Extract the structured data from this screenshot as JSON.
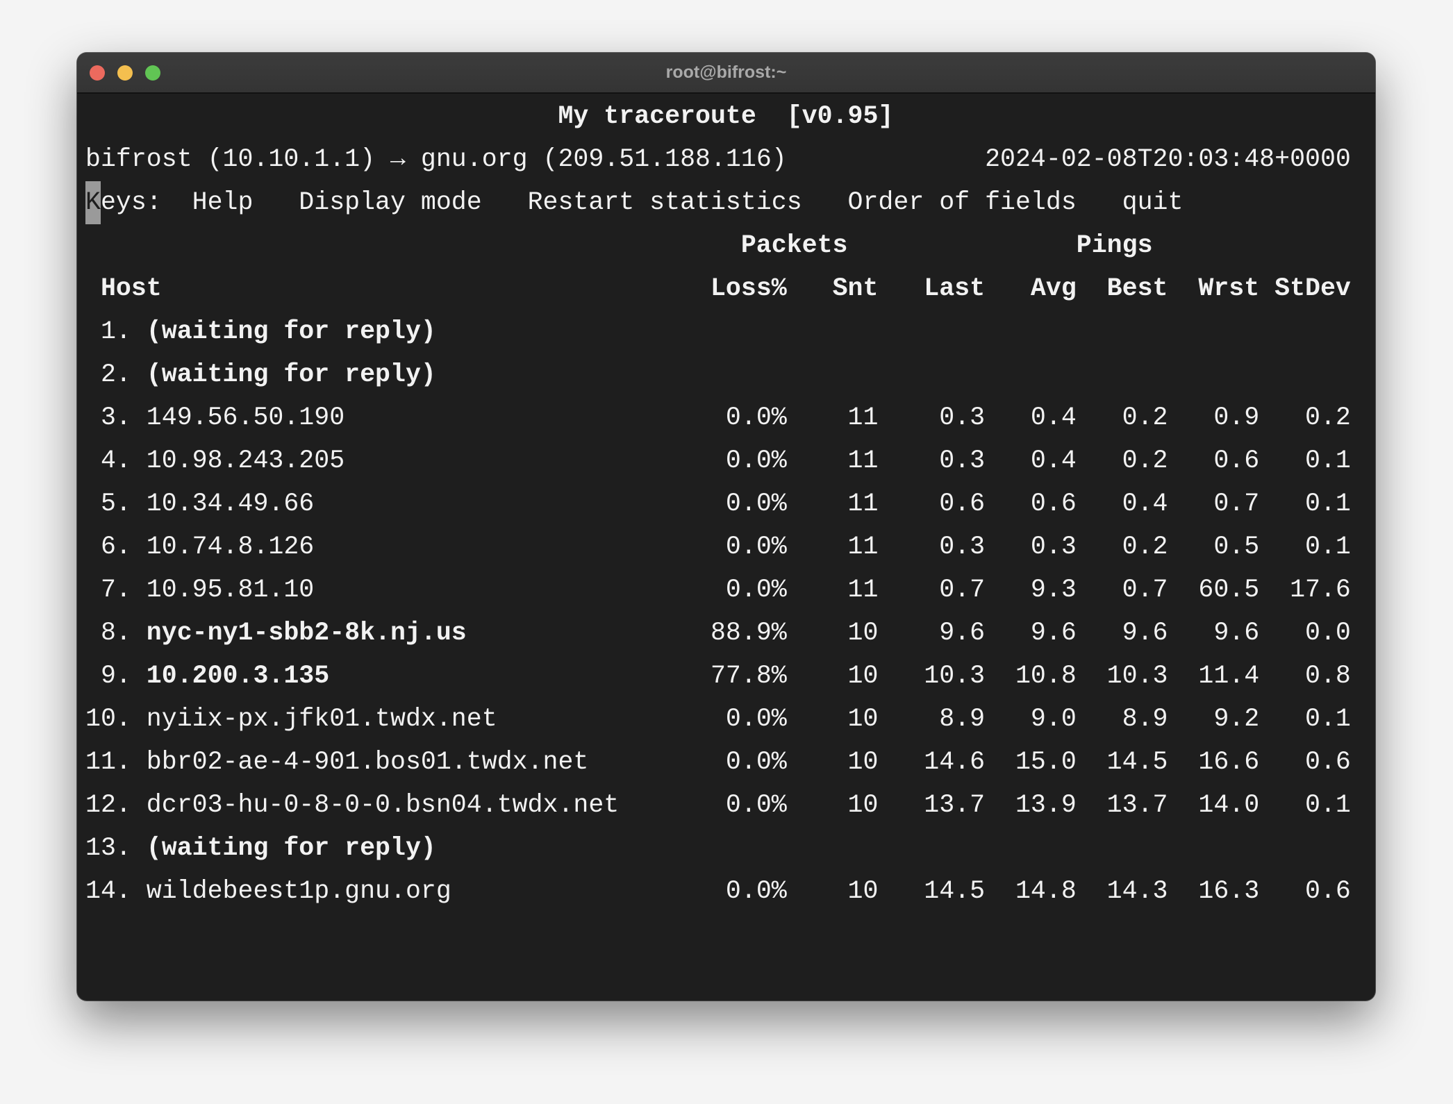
{
  "window": {
    "title": "root@bifrost:~",
    "lights": {
      "close": "#ec6a5e",
      "minimize": "#f4bf4f",
      "zoom": "#61c554"
    }
  },
  "header": {
    "title": "My traceroute  [v0.95]",
    "route": "bifrost (10.10.1.1) → gnu.org (209.51.188.116)",
    "timestamp": "2024-02-08T20:03:48+0000"
  },
  "keys": {
    "cursor_char": "K",
    "label": "eys:",
    "items": [
      "Help",
      "Display mode",
      "Restart statistics",
      "Order of fields",
      "quit"
    ]
  },
  "columns": {
    "group_packets": "Packets",
    "group_pings": "Pings",
    "host": "Host",
    "loss": "Loss%",
    "snt": "Snt",
    "last": "Last",
    "avg": "Avg",
    "best": "Best",
    "wrst": "Wrst",
    "stdev": "StDev"
  },
  "hops": [
    {
      "n": "1.",
      "host": "(waiting for reply)",
      "bold": true
    },
    {
      "n": "2.",
      "host": "(waiting for reply)",
      "bold": true
    },
    {
      "n": "3.",
      "host": "149.56.50.190",
      "loss": "0.0%",
      "snt": "11",
      "last": "0.3",
      "avg": "0.4",
      "best": "0.2",
      "wrst": "0.9",
      "stdev": "0.2"
    },
    {
      "n": "4.",
      "host": "10.98.243.205",
      "loss": "0.0%",
      "snt": "11",
      "last": "0.3",
      "avg": "0.4",
      "best": "0.2",
      "wrst": "0.6",
      "stdev": "0.1"
    },
    {
      "n": "5.",
      "host": "10.34.49.66",
      "loss": "0.0%",
      "snt": "11",
      "last": "0.6",
      "avg": "0.6",
      "best": "0.4",
      "wrst": "0.7",
      "stdev": "0.1"
    },
    {
      "n": "6.",
      "host": "10.74.8.126",
      "loss": "0.0%",
      "snt": "11",
      "last": "0.3",
      "avg": "0.3",
      "best": "0.2",
      "wrst": "0.5",
      "stdev": "0.1"
    },
    {
      "n": "7.",
      "host": "10.95.81.10",
      "loss": "0.0%",
      "snt": "11",
      "last": "0.7",
      "avg": "9.3",
      "best": "0.7",
      "wrst": "60.5",
      "stdev": "17.6"
    },
    {
      "n": "8.",
      "host": "nyc-ny1-sbb2-8k.nj.us",
      "bold": true,
      "loss": "88.9%",
      "snt": "10",
      "last": "9.6",
      "avg": "9.6",
      "best": "9.6",
      "wrst": "9.6",
      "stdev": "0.0"
    },
    {
      "n": "9.",
      "host": "10.200.3.135",
      "bold": true,
      "loss": "77.8%",
      "snt": "10",
      "last": "10.3",
      "avg": "10.8",
      "best": "10.3",
      "wrst": "11.4",
      "stdev": "0.8"
    },
    {
      "n": "10.",
      "host": "nyiix-px.jfk01.twdx.net",
      "loss": "0.0%",
      "snt": "10",
      "last": "8.9",
      "avg": "9.0",
      "best": "8.9",
      "wrst": "9.2",
      "stdev": "0.1"
    },
    {
      "n": "11.",
      "host": "bbr02-ae-4-901.bos01.twdx.net",
      "loss": "0.0%",
      "snt": "10",
      "last": "14.6",
      "avg": "15.0",
      "best": "14.5",
      "wrst": "16.6",
      "stdev": "0.6"
    },
    {
      "n": "12.",
      "host": "dcr03-hu-0-8-0-0.bsn04.twdx.net",
      "loss": "0.0%",
      "snt": "10",
      "last": "13.7",
      "avg": "13.9",
      "best": "13.7",
      "wrst": "14.0",
      "stdev": "0.1"
    },
    {
      "n": "13.",
      "host": "(waiting for reply)",
      "bold": true
    },
    {
      "n": "14.",
      "host": "wildebeest1p.gnu.org",
      "loss": "0.0%",
      "snt": "10",
      "last": "14.5",
      "avg": "14.8",
      "best": "14.3",
      "wrst": "16.3",
      "stdev": "0.6"
    }
  ]
}
